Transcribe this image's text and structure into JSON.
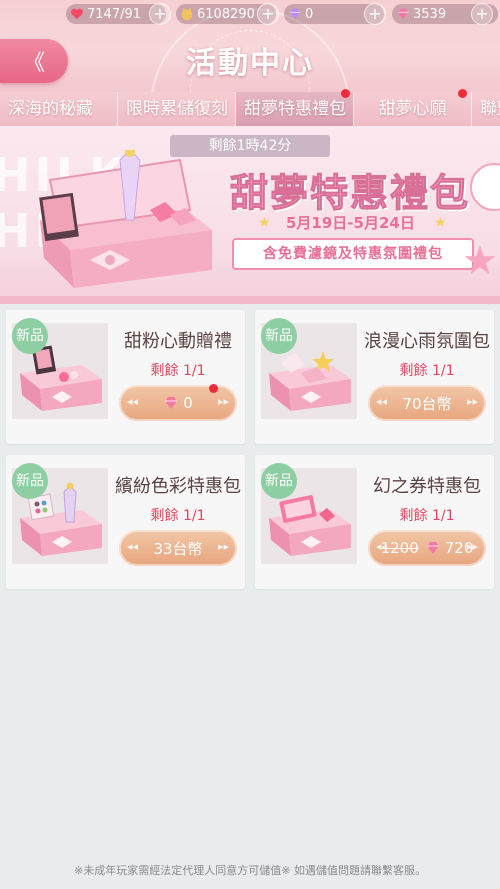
{
  "resources": [
    {
      "icon": "heart-icon",
      "value": "7147/91"
    },
    {
      "icon": "cat-coin-icon",
      "value": "6108290"
    },
    {
      "icon": "diamond-icon",
      "value": "0"
    },
    {
      "icon": "pink-diamond-icon",
      "value": "3539"
    }
  ],
  "header": {
    "title": "活動中心",
    "back_label": "《"
  },
  "tabs": [
    {
      "label": "深海的秘藏",
      "active": false
    },
    {
      "label": "限時累儲復刻",
      "active": false
    },
    {
      "label": "甜夢特惠禮包",
      "active": true
    },
    {
      "label": "甜夢心願",
      "active": false
    },
    {
      "label": "聯盟",
      "active": false
    }
  ],
  "banner": {
    "timer": "剩餘1時42分",
    "title": "甜夢特惠禮包",
    "date": "5月19日-5月24日",
    "description": "含免費濾鏡及特惠氛圍禮包",
    "watermark": "HILKI"
  },
  "products": [
    {
      "badge": "新品",
      "name": "甜粉心動贈禮",
      "remaining": "剩餘 1/1",
      "price": "0",
      "price_type": "diamond",
      "original_price": ""
    },
    {
      "badge": "新品",
      "name": "浪漫心雨氛圍包",
      "remaining": "剩餘 1/1",
      "price": "70台幣",
      "price_type": "currency",
      "original_price": ""
    },
    {
      "badge": "新品",
      "name": "繽紛色彩特惠包",
      "remaining": "剩餘 1/1",
      "price": "33台幣",
      "price_type": "currency",
      "original_price": ""
    },
    {
      "badge": "新品",
      "name": "幻之券特惠包",
      "remaining": "剩餘 1/1",
      "price": "720",
      "price_type": "diamond",
      "original_price": "1200"
    }
  ],
  "footer": {
    "notice": "※未成年玩家需經法定代理人同意方可儲值※ 如遇儲值問題請聯繫客服。"
  },
  "colors": {
    "accent_pink": "#e76787",
    "badge_green": "#8dcfa3",
    "button_orange": "#e7a57e",
    "remain_red": "#e4465f"
  }
}
